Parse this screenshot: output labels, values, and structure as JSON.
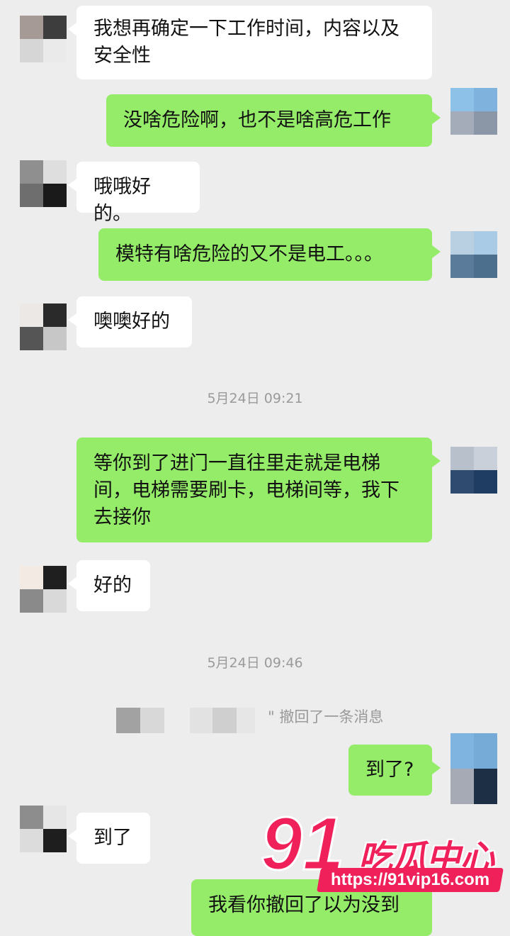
{
  "messages": {
    "m1": "我想再确定一下工作时间，内容以及安全性",
    "m2": "没啥危险啊，也不是啥高危工作",
    "m3": "哦哦好的。",
    "m4": "模特有啥危险的又不是电工。。。",
    "m5": "噢噢好的",
    "m6": "等你到了进门一直往里走就是电梯间，电梯需要刷卡，电梯间等，我下去接你",
    "m7": "好的",
    "m8": "到了?",
    "m9": "到了",
    "m10": "我看你撤回了以为没到"
  },
  "timestamps": {
    "t1": "5月24日 09:21",
    "t2": "5月24日 09:46"
  },
  "system": {
    "recall_text": "\" 撤回了一条消息"
  },
  "watermark": {
    "logo_number": "91",
    "logo_text": "吃瓜中心",
    "url": "https://91vip16.com"
  },
  "colors": {
    "background": "#ededed",
    "outgoing_bubble": "#95ec69",
    "incoming_bubble": "#ffffff",
    "watermark_pink": "#f0205a"
  }
}
